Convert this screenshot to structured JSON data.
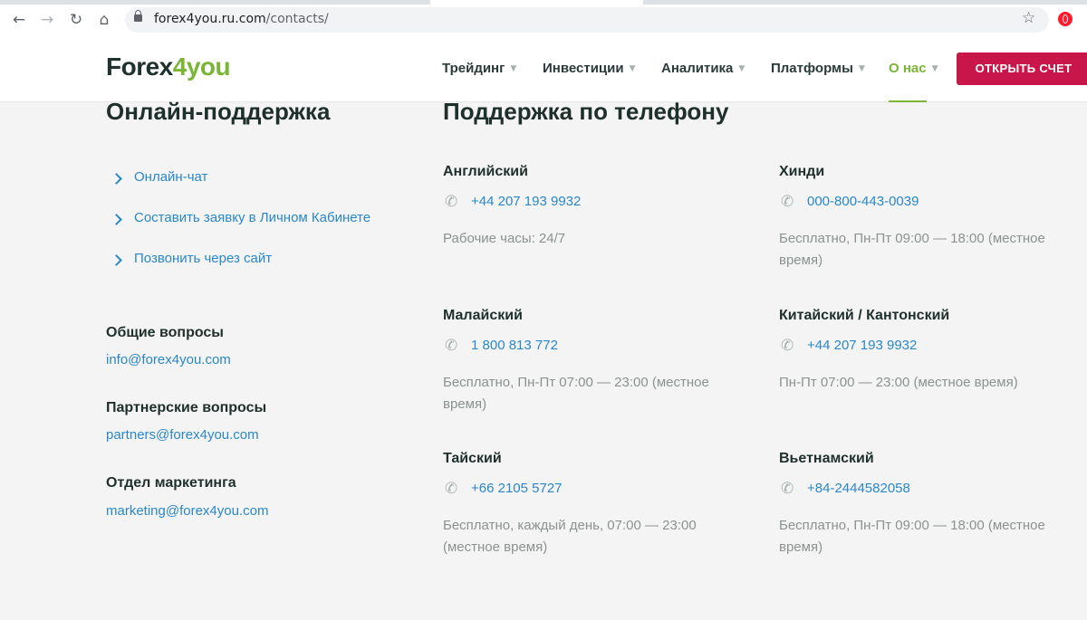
{
  "browser": {
    "url_host": "forex4you.ru.com",
    "url_path": "/contacts/"
  },
  "header": {
    "logo_part1": "Forex",
    "logo_part2": "4you",
    "menu": [
      {
        "label": "Трейдинг"
      },
      {
        "label": "Инвестиции"
      },
      {
        "label": "Аналитика"
      },
      {
        "label": "Платформы"
      },
      {
        "label": "О нас",
        "active": true
      }
    ],
    "cta_label": "ОТКРЫТЬ СЧЕТ",
    "accent_color": "#7ab536",
    "cta_color": "#c9164a"
  },
  "online_support": {
    "title": "Онлайн-поддержка",
    "links": [
      "Онлайн-чат",
      "Составить заявку в Личном Кабинете",
      "Позвонить через сайт"
    ]
  },
  "contacts": [
    {
      "label": "Общие вопросы",
      "email": "info@forex4you.com"
    },
    {
      "label": "Партнерские вопросы",
      "email": "partners@forex4you.com"
    },
    {
      "label": "Отдел маркетинга",
      "email": "marketing@forex4you.com"
    }
  ],
  "phone_support": {
    "title": "Поддержка по телефону",
    "entries": [
      {
        "language": "Английский",
        "phone": "+44 207 193 9932",
        "hours": "Рабочие часы: 24/7"
      },
      {
        "language": "Хинди",
        "phone": "000-800-443-0039",
        "hours": "Бесплатно, Пн-Пт 09:00 — 18:00 (местное время)"
      },
      {
        "language": "Малайский",
        "phone": "1 800 813 772",
        "hours": "Бесплатно, Пн-Пт 07:00 — 23:00 (местное время)"
      },
      {
        "language": "Китайский / Кантонский",
        "phone": "+44 207 193 9932",
        "hours": "Пн-Пт 07:00 — 23:00 (местное время)"
      },
      {
        "language": "Тайский",
        "phone": "+66 2105 5727",
        "hours": "Бесплатно, каждый день, 07:00 — 23:00 (местное время)"
      },
      {
        "language": "Вьетнамский",
        "phone": "+84-2444582058",
        "hours": "Бесплатно, Пн-Пт 09:00 — 18:00 (местное время)"
      }
    ]
  }
}
